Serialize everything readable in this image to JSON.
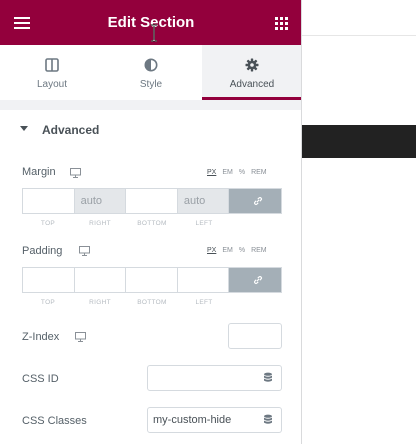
{
  "header": {
    "title": "Edit Section"
  },
  "tabs": [
    {
      "label": "Layout",
      "icon": "columns-icon"
    },
    {
      "label": "Style",
      "icon": "half-circle-icon"
    },
    {
      "label": "Advanced",
      "icon": "gear-icon",
      "active": true
    }
  ],
  "section": {
    "title": "Advanced"
  },
  "units": [
    "PX",
    "EM",
    "%",
    "REM"
  ],
  "margin": {
    "label": "Margin",
    "top": "",
    "right": "auto",
    "bottom": "",
    "left": "auto",
    "side_labels": [
      "TOP",
      "RIGHT",
      "BOTTOM",
      "LEFT"
    ]
  },
  "padding": {
    "label": "Padding",
    "top": "",
    "right": "",
    "bottom": "",
    "left": "",
    "side_labels": [
      "TOP",
      "RIGHT",
      "BOTTOM",
      "LEFT"
    ]
  },
  "zindex": {
    "label": "Z-Index",
    "value": ""
  },
  "css_id": {
    "label": "CSS ID",
    "value": ""
  },
  "css_classes": {
    "label": "CSS Classes",
    "value": "my-custom-hide"
  },
  "colors": {
    "brand": "#93003c",
    "link_active": "#a4afb7"
  }
}
